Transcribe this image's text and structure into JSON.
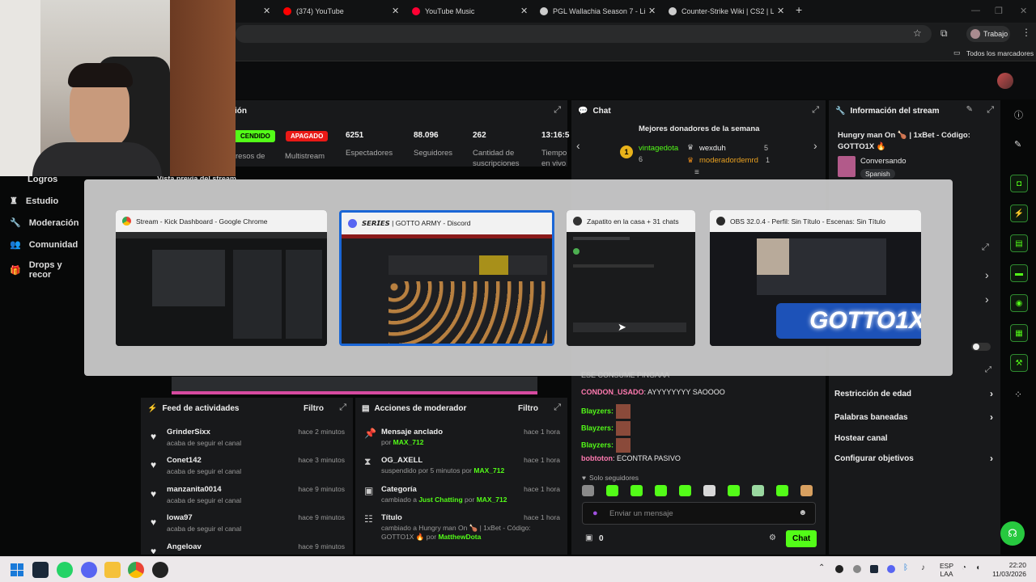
{
  "browser": {
    "tabs": [
      {
        "label": "(374) YouTube",
        "color": "#ff0000"
      },
      {
        "label": "YouTube Music",
        "color": "#ff0033"
      },
      {
        "label": "PGL Wallachia Season 7 - Liquip",
        "color": "#dddddd"
      },
      {
        "label": "Counter-Strike Wiki | CS2 | Liqu",
        "color": "#dddddd"
      }
    ],
    "profile_label": "Trabajo",
    "bookmarks_label": "Todos los marcadores"
  },
  "sidebar": {
    "items": [
      {
        "label": "Logros",
        "icon": "trophy-icon"
      },
      {
        "label": "Estudio",
        "icon": "studio-icon"
      },
      {
        "label": "Moderación",
        "icon": "wrench-icon"
      },
      {
        "label": "Comunidad",
        "icon": "users-icon"
      },
      {
        "label": "Drops y recor",
        "icon": "gift-icon"
      }
    ]
  },
  "session": {
    "title_fragment": "ión",
    "status_on": "CENDIDO",
    "status_off": "APAGADO",
    "multistream": "Multistream",
    "ingresos_fragment": "resos de",
    "ingresos_fragment2": "ón",
    "stats": [
      {
        "value": "6251",
        "label": "Espectadores"
      },
      {
        "value": "88.096",
        "label": "Seguidores"
      },
      {
        "value": "262",
        "label": "Cantidad de suscripciones"
      },
      {
        "value": "13:16:5",
        "label": "Tiempo en vivo"
      }
    ],
    "preview_label": "Vista previa del stream"
  },
  "chat": {
    "title": "Chat",
    "donors_title": "Mejores donadores de la semana",
    "donors": [
      {
        "rank": "1",
        "name": "vintagedota",
        "amount": "6"
      },
      {
        "name": "wexduh",
        "amount": "5"
      },
      {
        "name": "moderadordemrd",
        "amount": "1"
      }
    ],
    "messages_top_fragment": "ESE CONSUME PINGAAA",
    "messages": [
      {
        "user": "CONDON_USADO",
        "text": ": AYYYYYYYY SAOOOO",
        "color": "#ff7ab0"
      },
      {
        "user": "Blayzers:",
        "text": "",
        "color": "#53fc18"
      },
      {
        "user": "Blayzers:",
        "text": "",
        "color": "#53fc18"
      },
      {
        "user": "Blayzers:",
        "text": "",
        "color": "#53fc18"
      },
      {
        "user": "bobtoton",
        "text": ": ECONTRA PASIVO",
        "color": "#ff7ab0"
      }
    ],
    "followers_only": "Solo seguidores",
    "input_placeholder": "Enviar un mensaje",
    "points": "0",
    "send_label": "Chat"
  },
  "stream_info": {
    "title": "Información del stream",
    "stream_title": "Hungry man On 🍗 | 1xBet - Código: GOTTO1X 🔥",
    "category": "Conversando",
    "language": "Spanish"
  },
  "settings": {
    "items": [
      "Restricción de edad",
      "Palabras baneadas",
      "Hostear canal",
      "Configurar objetivos"
    ]
  },
  "activity": {
    "title": "Feed de actividades",
    "filter": "Filtro",
    "items": [
      {
        "name": "GrinderSixx",
        "sub": "acaba de seguir el canal",
        "time": "hace 2 minutos"
      },
      {
        "name": "Conet142",
        "sub": "acaba de seguir el canal",
        "time": "hace 3 minutos"
      },
      {
        "name": "manzanita0014",
        "sub": "acaba de seguir el canal",
        "time": "hace 9 minutos"
      },
      {
        "name": "lowa97",
        "sub": "acaba de seguir el canal",
        "time": "hace 9 minutos"
      },
      {
        "name": "Angeloav",
        "sub": "",
        "time": "hace 9 minutos"
      }
    ]
  },
  "modactions": {
    "title": "Acciones de moderador",
    "filter": "Filtro",
    "items": [
      {
        "name": "Mensaje anclado",
        "sub": "por",
        "user": "MAX_712",
        "time": "hace 1 hora"
      },
      {
        "name": "OG_AXELL",
        "sub": "suspendido por 5 minutos por",
        "user": "MAX_712",
        "time": "hace 1 hora"
      },
      {
        "name": "Categoría",
        "sub": "cambiado a",
        "sub_green": "Just Chatting",
        "sub2": "por",
        "user": "MAX_712",
        "time": "hace 1 hora"
      },
      {
        "name": "Título",
        "sub": "cambiado a Hungry man On 🍗 | 1xBet - Código: GOTTO1X 🔥 por",
        "user": "MatthewDota",
        "time": "hace 1 hora"
      }
    ]
  },
  "switcher": {
    "windows": [
      {
        "title": "Stream - Kick Dashboard - Google Chrome",
        "icon": "chrome-icon"
      },
      {
        "title": "𝙎𝙀𝙍𝙄𝙀𝙎 | GOTTO ARMY - Discord",
        "icon": "discord-icon"
      },
      {
        "title": "Zapatito en la casa + 31 chats",
        "icon": "app-icon"
      },
      {
        "title": "OBS 32.0.4 - Perfil: Sin Título - Escenas: Sin Título",
        "icon": "obs-icon"
      }
    ],
    "overlay_text": "GOTTO1X"
  },
  "taskbar": {
    "lang": "ESP",
    "lang2": "LAA",
    "time": "22:20",
    "date": "11/03/2026"
  }
}
